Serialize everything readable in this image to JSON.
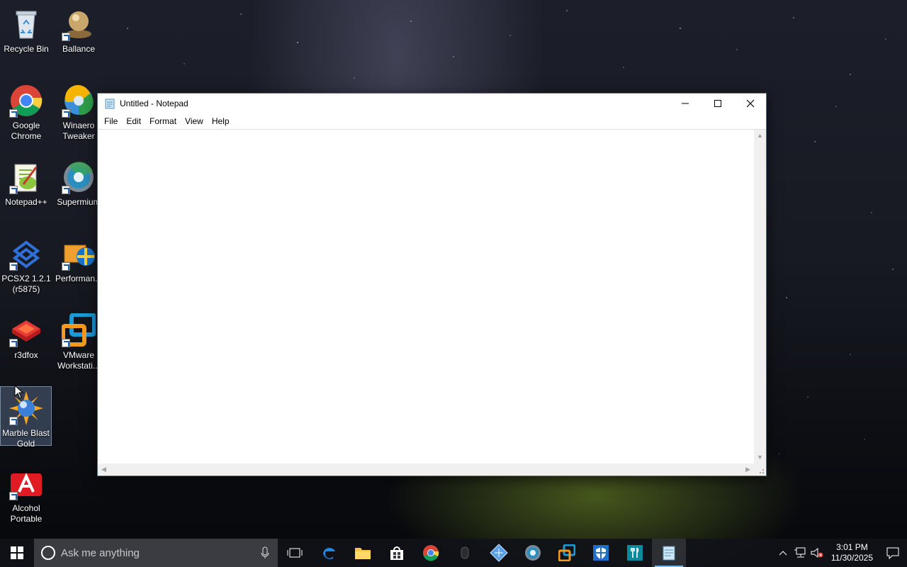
{
  "desktop": {
    "icons": [
      {
        "label": "Recycle Bin",
        "icon": "recycle-bin-icon"
      },
      {
        "label": "Ballance",
        "icon": "ballance-icon"
      },
      {
        "label": "Google Chrome",
        "icon": "chrome-icon"
      },
      {
        "label": "Winaero Tweaker",
        "icon": "winaero-icon"
      },
      {
        "label": "Notepad++",
        "icon": "notepadpp-icon"
      },
      {
        "label": "Supermium",
        "icon": "supermium-icon"
      },
      {
        "label": "PCSX2 1.2.1 (r5875)",
        "icon": "pcsx2-icon"
      },
      {
        "label": "Performan...",
        "icon": "performance-icon"
      },
      {
        "label": "r3dfox",
        "icon": "r3dfox-icon"
      },
      {
        "label": "VMware Workstati...",
        "icon": "vmware-icon"
      },
      {
        "label": "Marble Blast Gold",
        "icon": "marble-blast-icon"
      },
      {
        "label": "Alcohol Portable",
        "icon": "alcohol-icon"
      }
    ]
  },
  "notepad": {
    "title": "Untitled - Notepad",
    "menu": [
      "File",
      "Edit",
      "Format",
      "View",
      "Help"
    ],
    "content": ""
  },
  "taskbar": {
    "search_placeholder": "Ask me anything",
    "apps": [
      "task-view-icon",
      "edge-icon",
      "file-explorer-icon",
      "store-icon",
      "chrome-icon",
      "mouse-icon",
      "winaero-icon",
      "supermium-icon",
      "vmware-icon",
      "defender-icon",
      "food-app-icon",
      "notepad-icon"
    ],
    "time": "3:01 PM",
    "date": "11/30/2025"
  },
  "colors": {
    "accent": "#1883d7",
    "taskbar": "#101218",
    "search": "#3a3c42"
  }
}
